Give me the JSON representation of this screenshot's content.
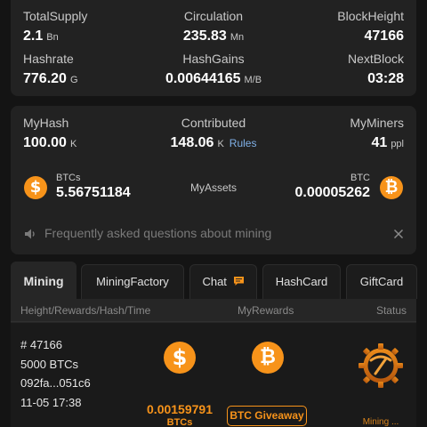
{
  "stats": {
    "total_supply": {
      "label": "TotalSupply",
      "value": "2.1",
      "unit": "Bn"
    },
    "circulation": {
      "label": "Circulation",
      "value": "235.83",
      "unit": "Mn"
    },
    "block_height": {
      "label": "BlockHeight",
      "value": "47166"
    },
    "hashrate": {
      "label": "Hashrate",
      "value": "776.20",
      "unit": "G"
    },
    "hash_gains": {
      "label": "HashGains",
      "value": "0.00644165",
      "unit": "M/B"
    },
    "next_block": {
      "label": "NextBlock",
      "value": "03:28"
    }
  },
  "my": {
    "my_hash": {
      "label": "MyHash",
      "value": "100.00",
      "unit": "K"
    },
    "contributed": {
      "label": "Contributed",
      "value": "148.06",
      "unit": "K",
      "link": "Rules"
    },
    "my_miners": {
      "label": "MyMiners",
      "value": "41",
      "unit": "ppl"
    },
    "assets_label": "MyAssets",
    "btcs": {
      "label": "BTCs",
      "value": "5.56751184",
      "icon": "dollar-coin-icon"
    },
    "btc": {
      "label": "BTC",
      "value": "0.00005262",
      "icon": "bitcoin-coin-icon"
    }
  },
  "faq": {
    "text": "Frequently asked questions about mining",
    "icon": "speaker-icon",
    "close_icon": "close-icon"
  },
  "tabs": [
    {
      "label": "Mining",
      "active": true
    },
    {
      "label": "MiningFactory"
    },
    {
      "label": "Chat",
      "icon": "chat-bubble-icon"
    },
    {
      "label": "HashCard"
    },
    {
      "label": "GiftCard"
    }
  ],
  "table": {
    "headers": [
      "Height/Rewards/Hash/Time",
      "MyRewards",
      "Status"
    ],
    "rows": [
      {
        "height": "# 47166",
        "rewards": "5000 BTCs",
        "hash": "092fa...051c6",
        "time": "11-05 17:38",
        "reward_amount": "0.00159791",
        "reward_unit": "BTCs",
        "giveaway_label": "BTC Giveaway",
        "status": "Mining ..."
      }
    ]
  },
  "colors": {
    "accent": "#f7931a",
    "card": "#222222",
    "background": "#141414",
    "link": "#7fb0e6"
  }
}
